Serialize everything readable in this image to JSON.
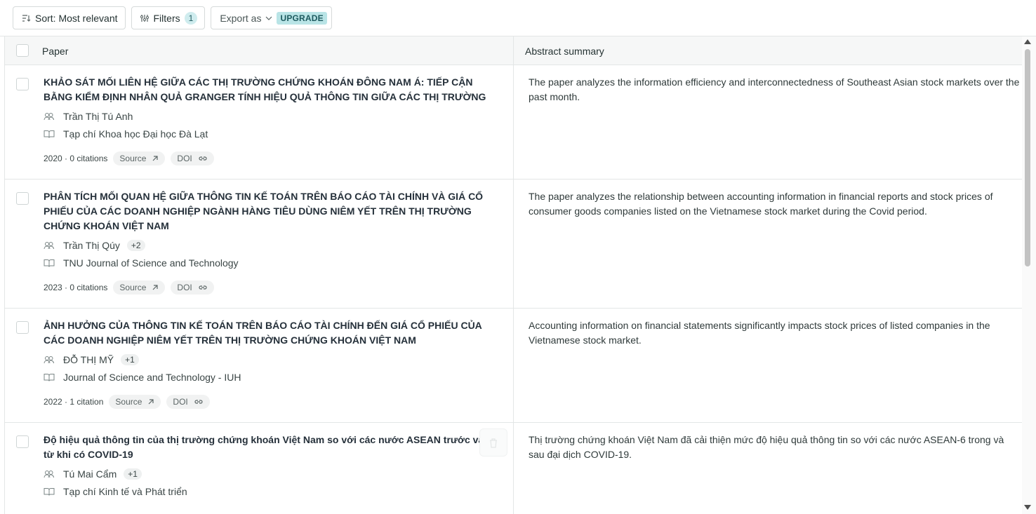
{
  "toolbar": {
    "sort_label": "Sort: Most relevant",
    "filters_label": "Filters",
    "filters_count": "1",
    "export_label": "Export as",
    "upgrade_badge": "UPGRADE"
  },
  "table": {
    "col_paper": "Paper",
    "col_abstract": "Abstract summary"
  },
  "rows": [
    {
      "title": "KHẢO SÁT MỐI LIÊN HỆ GIỮA CÁC THỊ TRƯỜNG CHỨNG KHOÁN ĐÔNG NAM Á: TIẾP CẬN BẰNG KIỂM ĐỊNH NHÂN QUẢ GRANGER TÍNH HIỆU QUẢ THÔNG TIN GIỮA CÁC THỊ TRƯỜNG",
      "author": "Trần Thị Tú Anh",
      "extra_authors": "",
      "journal": "Tạp chí Khoa học Đại học Đà Lạt",
      "year_citations": "2020 · 0 citations",
      "source": "Source",
      "doi": "DOI",
      "abstract": "The paper analyzes the information efficiency and interconnectedness of Southeast Asian stock markets over the past month."
    },
    {
      "title": "PHÂN TÍCH MỐI QUAN HỆ GIỮA THÔNG TIN KẾ TOÁN TRÊN BÁO CÁO TÀI CHÍNH VÀ GIÁ CỔ PHIẾU CỦA CÁC DOANH NGHIỆP NGÀNH HÀNG TIÊU DÙNG NIÊM YẾT TRÊN THỊ TRƯỜNG CHỨNG KHOÁN VIỆT NAM",
      "author": "Trần Thị Qúy",
      "extra_authors": "+2",
      "journal": "TNU Journal of Science and Technology",
      "year_citations": "2023 · 0 citations",
      "source": "Source",
      "doi": "DOI",
      "abstract": "The paper analyzes the relationship between accounting information in financial reports and stock prices of consumer goods companies listed on the Vietnamese stock market during the Covid period."
    },
    {
      "title": "ẢNH HƯỞNG CỦA THÔNG TIN KẾ TOÁN TRÊN BÁO CÁO TÀI CHÍNH ĐẾN GIÁ CỔ PHIẾU CỦA CÁC DOANH NGHIỆP NIÊM YẾT TRÊN THỊ TRƯỜNG CHỨNG KHOÁN VIỆT NAM",
      "author": "ĐỖ THỊ MỸ",
      "extra_authors": "+1",
      "journal": "Journal of Science and Technology - IUH",
      "year_citations": "2022 · 1 citation",
      "source": "Source",
      "doi": "DOI",
      "abstract": "Accounting information on financial statements significantly impacts stock prices of listed companies in the Vietnamese stock market."
    },
    {
      "title": "Độ hiệu quả thông tin của thị trường chứng khoán Việt Nam so với các nước ASEAN trước và từ khi có COVID-19",
      "author": "Tú Mai Cẩm",
      "extra_authors": "+1",
      "journal": "Tạp chí Kinh tế và Phát triển",
      "year_citations": "",
      "source": "",
      "doi": "",
      "abstract": "Thị trường chứng khoán Việt Nam đã cải thiện mức độ hiệu quả thông tin so với các nước ASEAN-6 trong và sau đại dịch COVID-19."
    }
  ]
}
